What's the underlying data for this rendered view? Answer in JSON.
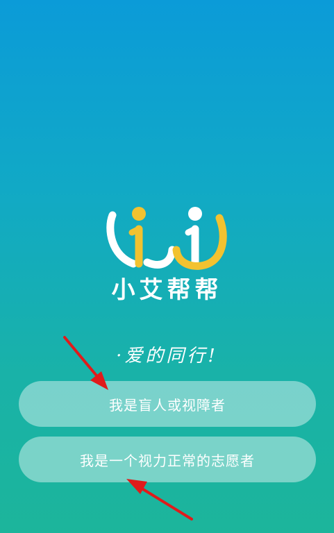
{
  "app": {
    "name": "小艾帮帮",
    "slogan": "·爱的同行!"
  },
  "buttons": {
    "blind_label": "我是盲人或视障者",
    "volunteer_label": "我是一个视力正常的志愿者"
  },
  "colors": {
    "gradient_top": "#0b9bd8",
    "gradient_bottom": "#1cb59b",
    "logo_yellow": "#f2c230",
    "logo_white": "#ffffff",
    "arrow_red": "#e01b1b"
  },
  "icons": {
    "logo": "xiaoai-logo-icon",
    "arrow_top": "red-arrow-icon",
    "arrow_bottom": "red-arrow-icon"
  }
}
